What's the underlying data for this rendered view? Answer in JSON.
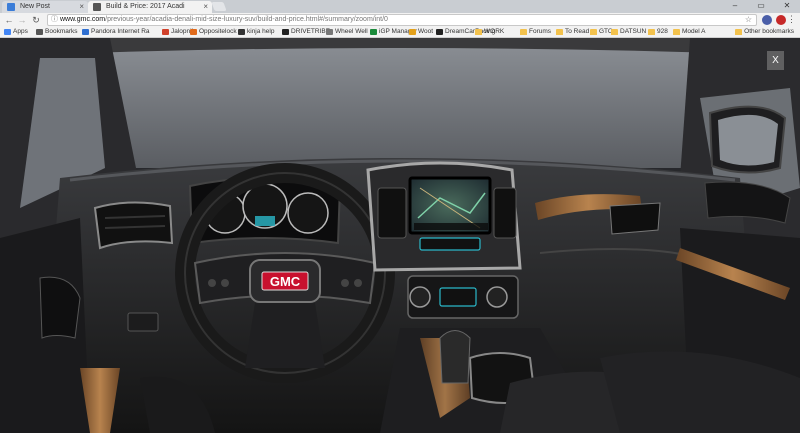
{
  "browser": {
    "tabs": [
      {
        "title": "New Post",
        "favicon_color": "#3b7dd8",
        "active": false
      },
      {
        "title": "Build & Price: 2017 Acadi",
        "favicon_color": "#555555",
        "active": true
      }
    ],
    "url": {
      "domain": "www.gmc.com",
      "path": "/previous-year/acadia-denali-mid-size-luxury-suv/build-and-price.html#/summary/zoom/int/0"
    },
    "bookmarks": [
      {
        "label": "Apps",
        "icon": "apps-icon",
        "color": "#4285f4"
      },
      {
        "label": "Bookmarks",
        "icon": "star-icon",
        "color": "#555555"
      },
      {
        "label": "Pandora Internet Ra",
        "icon": "pandora-icon",
        "color": "#2f6fd1"
      },
      {
        "label": "Jalopnik",
        "icon": "jalopnik-icon",
        "color": "#d0402a"
      },
      {
        "label": "Oppositelock",
        "icon": "oppositelock-icon",
        "color": "#e06a1b"
      },
      {
        "label": "kinja help",
        "icon": "kinja-icon",
        "color": "#333333"
      },
      {
        "label": "DRIVETRIBE",
        "icon": "drivetribe-icon",
        "color": "#222222"
      },
      {
        "label": "Wheel Well",
        "icon": "wheel-icon",
        "color": "#777777"
      },
      {
        "label": "iGP Manager",
        "icon": "igp-icon",
        "color": "#1a8a3a"
      },
      {
        "label": "Woot",
        "icon": "woot-icon",
        "color": "#e4a11b"
      },
      {
        "label": "DreamCarRacing",
        "icon": "dreamcar-icon",
        "color": "#222222"
      },
      {
        "label": "WORK",
        "icon": "folder-icon",
        "color": "#f3c24d"
      },
      {
        "label": "Forums",
        "icon": "folder-icon",
        "color": "#f3c24d"
      },
      {
        "label": "To Read",
        "icon": "folder-icon",
        "color": "#f3c24d"
      },
      {
        "label": "GTO",
        "icon": "folder-icon",
        "color": "#f3c24d"
      },
      {
        "label": "DATSUN",
        "icon": "folder-icon",
        "color": "#f3c24d"
      },
      {
        "label": "928",
        "icon": "folder-icon",
        "color": "#f3c24d"
      },
      {
        "label": "Model A",
        "icon": "folder-icon",
        "color": "#f3c24d"
      }
    ],
    "other_bookmarks": "Other bookmarks"
  },
  "viewer": {
    "close_label": "X",
    "badge_text": "GMC",
    "accent_color": "#c8102e",
    "screen_color": "#2bb8c9",
    "wood_color": "#9a6a3a"
  }
}
